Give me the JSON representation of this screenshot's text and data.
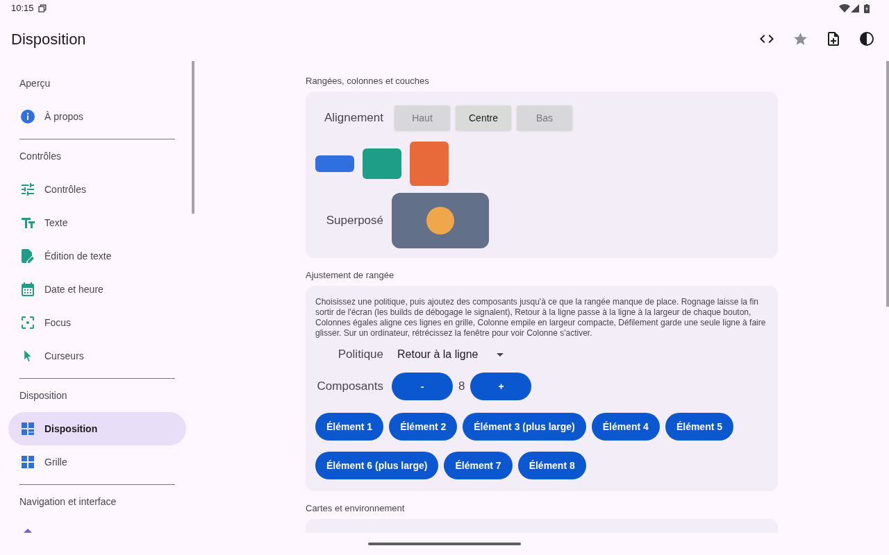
{
  "status_bar": {
    "time": "10:15"
  },
  "app_bar": {
    "title": "Disposition",
    "starred": false
  },
  "sidebar": {
    "sections": [
      {
        "header": "Aperçu",
        "items": [
          {
            "label": "À propos",
            "selected": false
          }
        ]
      },
      {
        "header": "Contrôles",
        "items": [
          {
            "label": "Contrôles",
            "selected": false
          },
          {
            "label": "Texte",
            "selected": false
          },
          {
            "label": "Édition de texte",
            "selected": false
          },
          {
            "label": "Date et heure",
            "selected": false
          },
          {
            "label": "Focus",
            "selected": false
          },
          {
            "label": "Curseurs",
            "selected": false
          }
        ]
      },
      {
        "header": "Disposition",
        "items": [
          {
            "label": "Disposition",
            "selected": true
          },
          {
            "label": "Grille",
            "selected": false
          }
        ]
      },
      {
        "header": "Navigation et interface",
        "items": [
          {
            "selected": false
          }
        ]
      }
    ]
  },
  "sections": [
    {
      "kind": "layers",
      "title": "Rangées, colonnes et couches",
      "alignment": {
        "label": "Alignement",
        "options": [
          {
            "label": "Haut",
            "selected": false
          },
          {
            "label": "Centre",
            "selected": true
          },
          {
            "label": "Bas",
            "selected": false
          }
        ]
      },
      "overlay": {
        "label": "Superposé"
      }
    },
    {
      "kind": "wrap",
      "title": "Ajustement de rangée",
      "description": "Choisissez une politique, puis ajoutez des composants jusqu'à ce que la rangée manque de place. Rognage laisse la fin sortir de l'écran (les builds de débogage le signalent), Retour à la ligne passe à la ligne à la largeur de chaque bouton, Colonnes égales aligne ces lignes en grille, Colonne empile en largeur compacte, Défilement garde une seule ligne à faire glisser. Sur un ordinateur, rétrécissez la fenêtre pour voir Colonne s'activer.",
      "policy": {
        "label": "Politique",
        "value": "Retour à la ligne"
      },
      "count": {
        "label": "Composants",
        "decrement": "-",
        "value": "8",
        "increment": "+"
      },
      "items": [
        "Élément 1",
        "Élément 2",
        "Élément 3 (plus large)",
        "Élément 4",
        "Élément 5",
        "Élément 6 (plus large)",
        "Élément 7",
        "Élément 8"
      ]
    },
    {
      "kind": "cards",
      "title": "Cartes et environnement"
    }
  ]
}
